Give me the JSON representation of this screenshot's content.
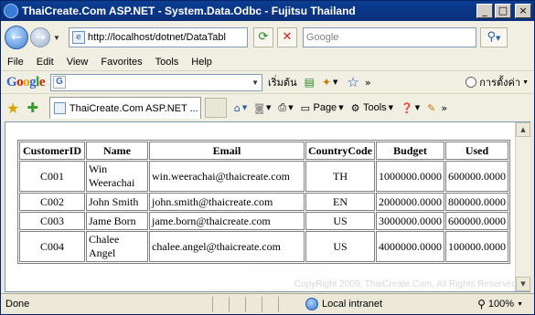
{
  "window": {
    "title": "ThaiCreate.Com ASP.NET - System.Data.Odbc - Fujitsu Thailand",
    "controls": {
      "minimize": "_",
      "maximize": "□",
      "close": "×"
    }
  },
  "addressbar": {
    "back_icon": "back-arrow-icon",
    "forward_icon": "forward-arrow-icon",
    "url": "http://localhost/dotnet/DataTabl",
    "search_placeholder": "Google"
  },
  "menu": {
    "items": [
      "File",
      "Edit",
      "View",
      "Favorites",
      "Tools",
      "Help"
    ]
  },
  "google_toolbar": {
    "logo": "Google",
    "search_g": "G",
    "start_label": "เริ่มต้น",
    "settings_label": "การตั้งค่า"
  },
  "tabbar": {
    "tab_title": "ThaiCreate.Com ASP.NET ...",
    "page_label": "Page",
    "tools_label": "Tools"
  },
  "table": {
    "headers": [
      "CustomerID",
      "Name",
      "Email",
      "CountryCode",
      "Budget",
      "Used"
    ],
    "rows": [
      [
        "C001",
        "Win Weerachai",
        "win.weerachai@thaicreate.com",
        "TH",
        "1000000.0000",
        "600000.0000"
      ],
      [
        "C002",
        "John Smith",
        "john.smith@thaicreate.com",
        "EN",
        "2000000.0000",
        "800000.0000"
      ],
      [
        "C003",
        "Jame Born",
        "jame.born@thaicreate.com",
        "US",
        "3000000.0000",
        "600000.0000"
      ],
      [
        "C004",
        "Chalee Angel",
        "chalee.angel@thaicreate.com",
        "US",
        "4000000.0000",
        "100000.0000"
      ]
    ]
  },
  "watermark": {
    "copyright": "CopyRight 2009, ThaiCreate.Com, All Rights Reserved"
  },
  "statusbar": {
    "status": "Done",
    "zone": "Local intranet",
    "zoom": "100%"
  }
}
